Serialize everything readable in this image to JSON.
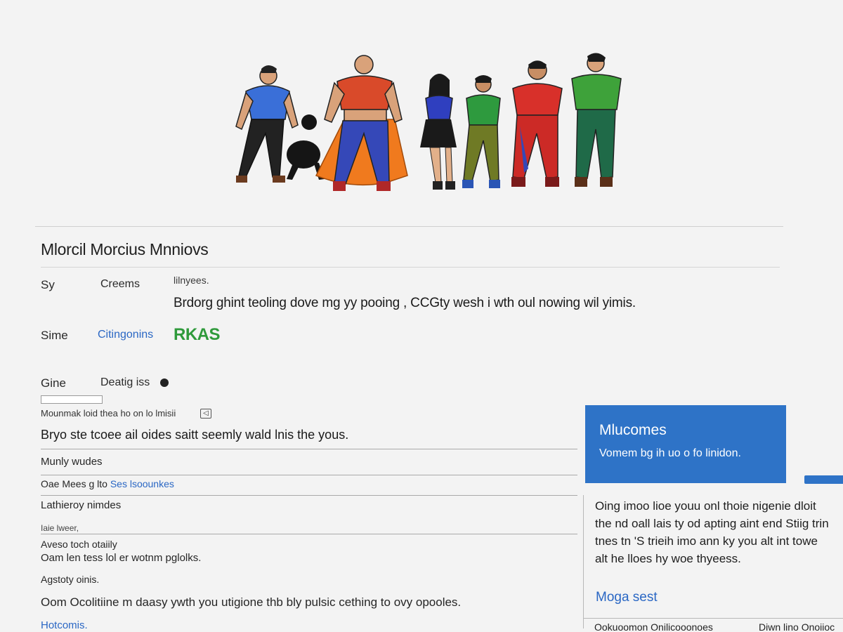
{
  "page": {
    "title": "Mlorcil Morcius Mnniovs"
  },
  "details": {
    "hint": "lilnyees.",
    "description": "Brdorg ghint teoling dove mg yy pooing , CCGty wesh i wth oul nowing wil yimis.",
    "rows": [
      {
        "label": "Sy",
        "sub": "Creems"
      },
      {
        "label": "Sime",
        "link": "Citingonins",
        "badge": "RKAS"
      },
      {
        "label": "Gine",
        "sub": "Deatig iss"
      }
    ],
    "note": "Mounmak loid thea ho on lo lmisii"
  },
  "list": {
    "lead": "Bryo ste tcoee ail oides saitt seemly wald lnis the yous.",
    "items": [
      "Munly wudes",
      "Oae Mees g lto",
      "Lathieroy nimdes",
      "Iaie lweer,",
      "Aveso toch otaiily",
      "Oam len tess lol er wotnm pglolks.",
      "Agstoty oinis.",
      "Oom Ocolitiine m daasy ywth you utigione thb bly pulsic cething to ovy opooles."
    ],
    "inline_link": "Ses lsoounkes",
    "final_link": "Hotcomis."
  },
  "panel": {
    "card_title": "Mlucomes",
    "card_sub": "Vomem bg ih uo o fo linidon.",
    "text_lines": [
      "Oing imoo lioe youu onl thoie nigenie dloit",
      "the nd oall lais ty od apting aint end Stiig trin",
      "tnes tn 'S trieih imo ann ky you alt int towe",
      "alt he lloes hy woe thyeess."
    ],
    "link": "Moga sest",
    "footer_left": "Ookuoomon Onilicooonoes",
    "footer_right": "Diwn lino Onoiioc"
  },
  "colors": {
    "accent_blue": "#2e73c7",
    "link_blue": "#2a67c4",
    "badge_green": "#2f9a3b"
  }
}
